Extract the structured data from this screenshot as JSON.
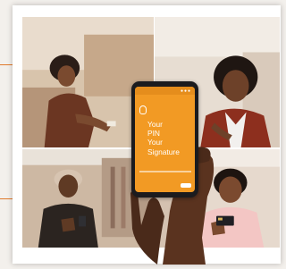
{
  "phone": {
    "headline_lines": [
      "Your",
      "PIN",
      "Your",
      "Signature"
    ]
  },
  "colors": {
    "accent": "#e07a2c",
    "screen": "#f29a24",
    "background": "#f3f0ec"
  },
  "icons": [
    "fingerprint-icon",
    "card-logo-icon"
  ]
}
